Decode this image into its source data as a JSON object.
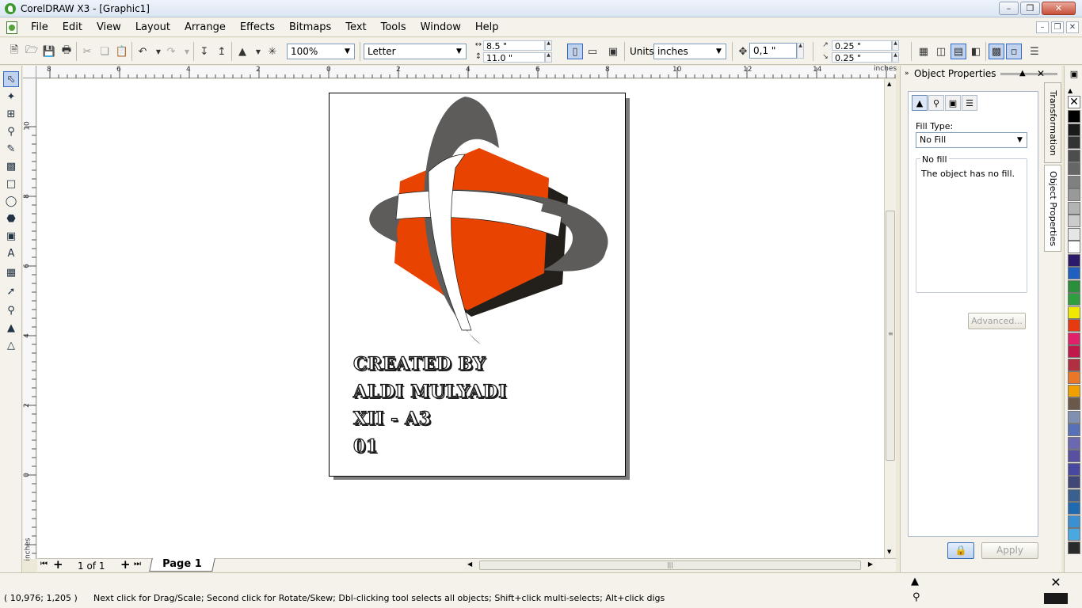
{
  "window": {
    "title": "CorelDRAW X3 - [Graphic1]"
  },
  "menu": {
    "items": [
      "File",
      "Edit",
      "View",
      "Layout",
      "Arrange",
      "Effects",
      "Bitmaps",
      "Text",
      "Tools",
      "Window",
      "Help"
    ]
  },
  "propbar": {
    "zoom": "100%",
    "paper": "Letter",
    "width": "8.5 \"",
    "height": "11.0 \"",
    "units_label": "Units:",
    "units": "inches",
    "nudge": "0,1 \"",
    "dup_x": "0.25 \"",
    "dup_y": "0.25 \""
  },
  "ruler": {
    "top_ticks": [
      "8",
      "6",
      "4",
      "2",
      "0",
      "2",
      "4",
      "6",
      "8",
      "10",
      "12",
      "14"
    ],
    "top_unit": "inches",
    "left_ticks": [
      "10",
      "8",
      "6",
      "4",
      "2",
      "0"
    ],
    "left_unit": "inches"
  },
  "artwork": {
    "credits": [
      "CREATED BY",
      "ALDI MULYADI",
      "XII - A3",
      "01"
    ],
    "colors": {
      "hexagon": "#e84300",
      "ring": "#5e5b5b",
      "shadow": "#231f1b"
    }
  },
  "pager": {
    "count": "1 of 1",
    "tab": "Page 1"
  },
  "docker": {
    "title": "Object Properties",
    "fill_type_label": "Fill Type:",
    "fill_type": "No Fill",
    "group_label": "No fill",
    "description": "The object has no fill.",
    "advanced_label": "Advanced...",
    "apply_label": "Apply",
    "tabs": [
      "Transformation",
      "Object Properties"
    ]
  },
  "palette": {
    "colors": [
      "#000000",
      "#1a1a1a",
      "#333333",
      "#4d4d4d",
      "#666666",
      "#808080",
      "#999999",
      "#b3b3b3",
      "#cccccc",
      "#e6e6e6",
      "#ffffff",
      "#2b1a6b",
      "#1f5fc0",
      "#2a8f3a",
      "#2f9e3f",
      "#f0e800",
      "#e83a10",
      "#e0206a",
      "#c01848",
      "#b03040",
      "#e87828",
      "#f0a000",
      "#6a5848",
      "#8090b0",
      "#5870b8",
      "#6a68b0",
      "#5850a0",
      "#4848a0",
      "#404878",
      "#3a6090",
      "#1f6ab0",
      "#3a90d0",
      "#4aa8e0",
      "#2a2a2a"
    ]
  },
  "status": {
    "coords": "( 10,976; 1,205 )",
    "message": "Next click for Drag/Scale; Second click for Rotate/Skew; Dbl-clicking tool selects all objects; Shift+click multi-selects; Alt+click digs"
  }
}
